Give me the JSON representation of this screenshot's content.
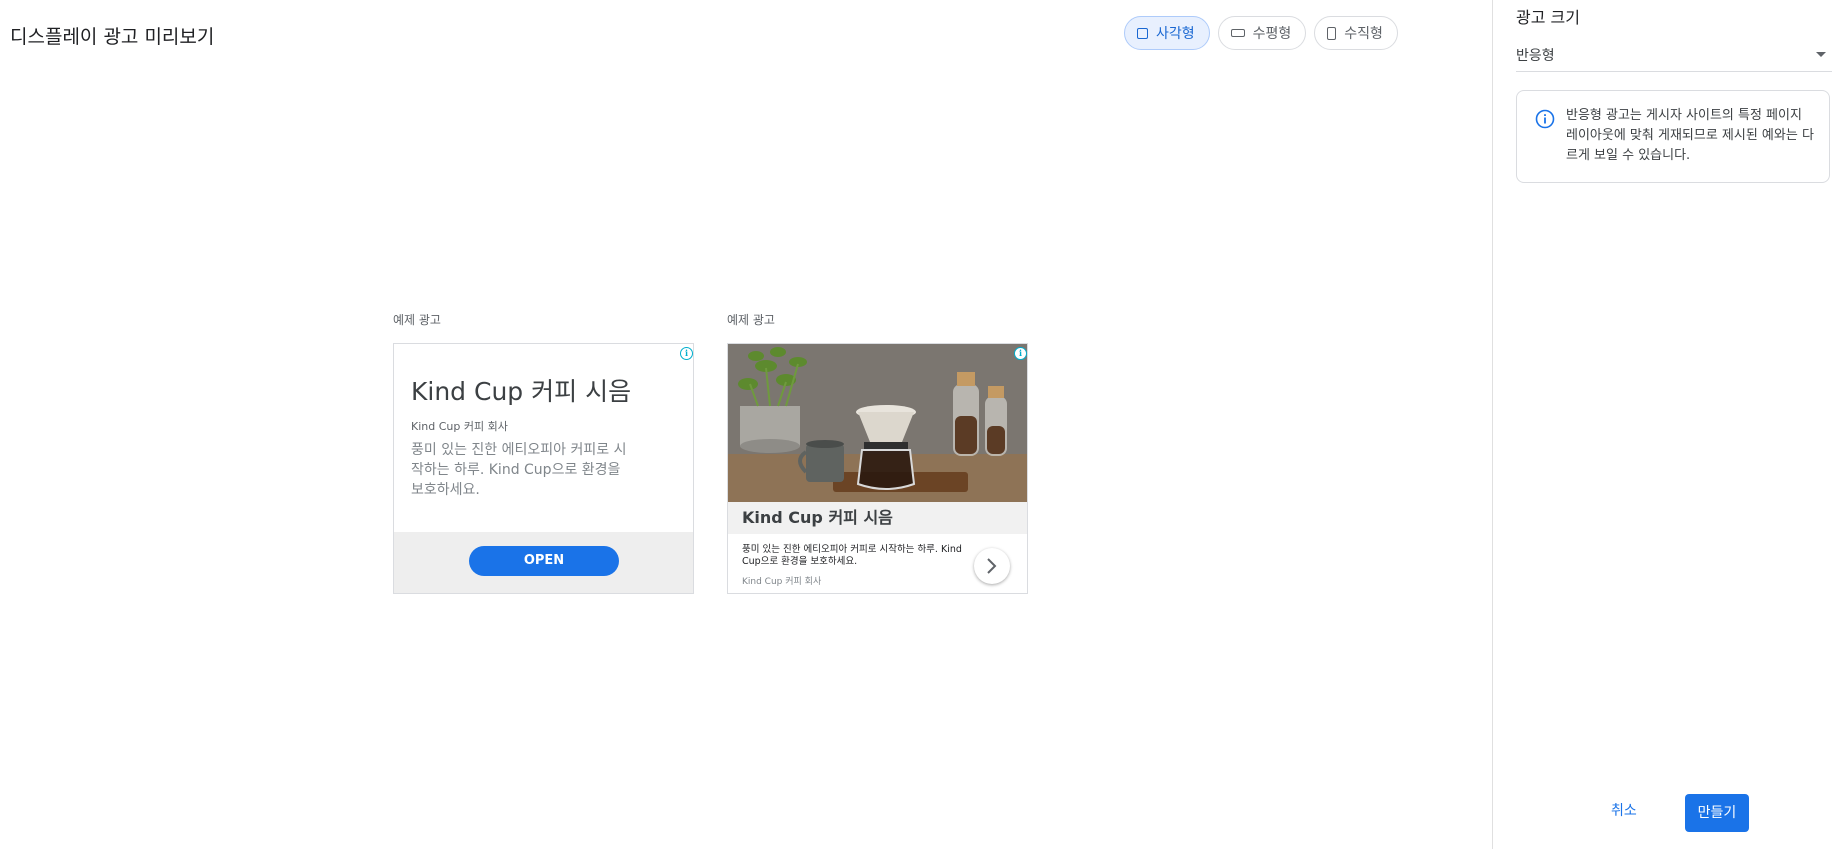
{
  "page": {
    "title": "디스플레이 광고 미리보기"
  },
  "formats": {
    "square_label": "사각형",
    "horizontal_label": "수평형",
    "vertical_label": "수직형",
    "selected": "square"
  },
  "previews": {
    "caption": "예제 광고",
    "ad1": {
      "headline": "Kind Cup 커피 시음",
      "advertiser": "Kind Cup 커피 회사",
      "description": "풍미 있는 진한 에티오피아 커피로 시작하는 하루. Kind Cup으로 환경을 보호하세요.",
      "button_label": "OPEN"
    },
    "ad2": {
      "headline": "Kind Cup 커피 시음",
      "description": "풍미 있는 진한 에티오피아 커피로 시작하는 하루. Kind Cup으로 환경을 보호하세요.",
      "advertiser": "Kind Cup 커피 회사"
    },
    "adchoices_icon": "info-icon"
  },
  "panel": {
    "heading": "광고 크기",
    "size_select": {
      "value": "반응형"
    },
    "info_text": "반응형 광고는 게시자 사이트의 특정 페이지 레이아웃에 맞춰 게재되므로 제시된 예와는 다르게 보일 수 있습니다.",
    "cancel_label": "취소",
    "create_label": "만들기"
  },
  "colors": {
    "accent": "#1a73e8",
    "selected_chip_bg": "#e8f0fe",
    "adchoices": "#00aecd"
  }
}
